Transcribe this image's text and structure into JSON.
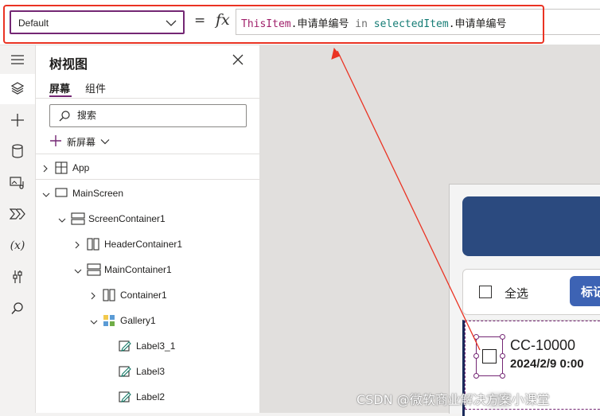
{
  "formula_bar": {
    "property_value": "Default",
    "equals": "=",
    "fx": "fx",
    "formula_tokens": [
      {
        "text": "ThisItem",
        "kind": "this"
      },
      {
        "text": ".申请单编号 ",
        "kind": "prop"
      },
      {
        "text": "in",
        "kind": "kw"
      },
      {
        "text": " ",
        "kind": "prop"
      },
      {
        "text": "selectedItem",
        "kind": "var"
      },
      {
        "text": ".申请单编号",
        "kind": "prop"
      }
    ]
  },
  "left_rail": {
    "icons": [
      "hamburger-icon",
      "layers-icon",
      "plus-icon",
      "database-icon",
      "media-icon",
      "power-automate-icon",
      "variables-icon",
      "tools-icon",
      "search-icon"
    ],
    "variables_glyph": "(x)"
  },
  "tree_panel": {
    "title": "树视图",
    "tabs": {
      "screens": "屏幕",
      "components": "组件"
    },
    "search_placeholder": "搜索",
    "new_screen_label": "新屏幕",
    "items": [
      {
        "label": "App",
        "icon": "app"
      },
      {
        "label": "MainScreen",
        "icon": "screen"
      },
      {
        "label": "ScreenContainer1",
        "icon": "vcontainer"
      },
      {
        "label": "HeaderContainer1",
        "icon": "hcontainer"
      },
      {
        "label": "MainContainer1",
        "icon": "vcontainer"
      },
      {
        "label": "Container1",
        "icon": "hcontainer"
      },
      {
        "label": "Gallery1",
        "icon": "gallery"
      },
      {
        "label": "Label3_1",
        "icon": "label"
      },
      {
        "label": "Label3",
        "icon": "label"
      },
      {
        "label": "Label2",
        "icon": "label"
      }
    ]
  },
  "canvas": {
    "select_all_label": "全选",
    "tag_button_label": "标记",
    "item_code": "CC-10000",
    "item_date": "2024/2/9 0:00"
  },
  "watermark": "CSDN @微软商业解决方案小课堂",
  "colors": {
    "accent": "#742774",
    "annotation_red": "#ea3323",
    "header_blue": "#2b4a7f",
    "button_blue": "#3d63b4"
  }
}
